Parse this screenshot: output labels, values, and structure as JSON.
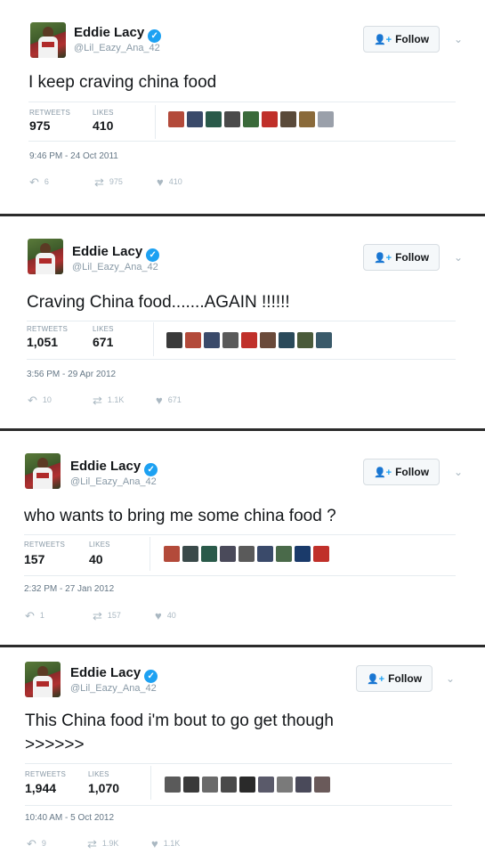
{
  "follow_label": "Follow",
  "tweets": [
    {
      "name": "Eddie Lacy",
      "handle": "@Lil_Eazy_Ana_42",
      "text": "I keep craving china food",
      "text2": "",
      "retweets_label": "RETWEETS",
      "likes_label": "LIKES",
      "retweets": "975",
      "likes": "410",
      "time": "9:46 PM - 24 Oct 2011",
      "reply_count": "6",
      "retweet_count": "975",
      "like_count": "410"
    },
    {
      "name": "Eddie Lacy",
      "handle": "@Lil_Eazy_Ana_42",
      "text": "Craving China food.......AGAIN !!!!!!",
      "text2": "",
      "retweets_label": "RETWEETS",
      "likes_label": "LIKES",
      "retweets": "1,051",
      "likes": "671",
      "time": "3:56 PM - 29 Apr 2012",
      "reply_count": "10",
      "retweet_count": "1.1K",
      "like_count": "671"
    },
    {
      "name": "Eddie Lacy",
      "handle": "@Lil_Eazy_Ana_42",
      "text": "who wants to bring me some china food ?",
      "text2": "",
      "retweets_label": "RETWEETS",
      "likes_label": "LIKES",
      "retweets": "157",
      "likes": "40",
      "time": "2:32 PM - 27 Jan 2012",
      "reply_count": "1",
      "retweet_count": "157",
      "like_count": "40"
    },
    {
      "name": "Eddie Lacy",
      "handle": "@Lil_Eazy_Ana_42",
      "text": "This China food i'm bout to go get though",
      "text2": ">>>>>>",
      "retweets_label": "RETWEETS",
      "likes_label": "LIKES",
      "retweets": "1,944",
      "likes": "1,070",
      "time": "10:40 AM - 5 Oct 2012",
      "reply_count": "9",
      "retweet_count": "1.9K",
      "like_count": "1.1K"
    }
  ],
  "icons": {
    "verified": "verified-check-icon",
    "follow": "add-user-icon",
    "caret": "chevron-down-icon",
    "reply": "reply-icon",
    "retweet": "retweet-icon",
    "like": "heart-icon"
  },
  "colors": {
    "accent": "#1da1f2",
    "muted": "#8899a6",
    "divider": "#2b2b2b"
  }
}
